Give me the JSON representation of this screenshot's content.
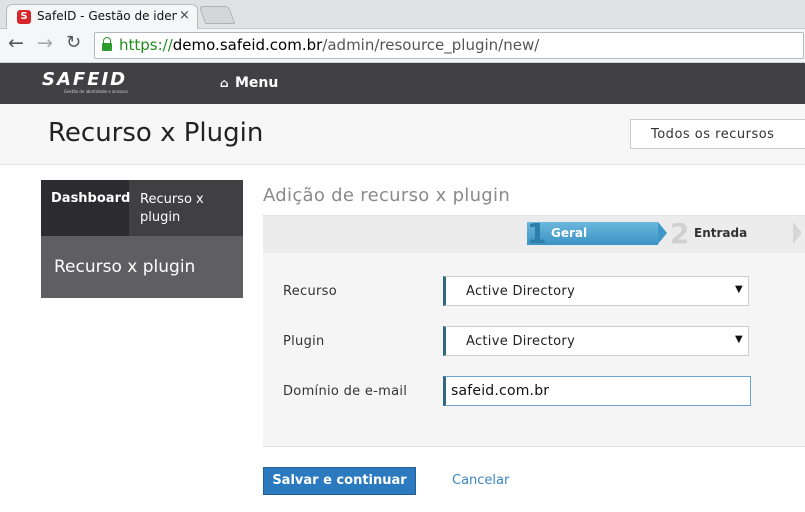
{
  "browser": {
    "tab_title": "SafeID - Gestão de identid",
    "tab_close": "×",
    "url_scheme": "https://",
    "url_host": "demo.safeid.com.br",
    "url_path": "/admin/resource_plugin/new/"
  },
  "appbar": {
    "logo": "SAFEID",
    "logo_tagline": "Gestão de identidade e acessos",
    "menu_label": "Menu",
    "menu_icon": "home-icon"
  },
  "header": {
    "title": "Recurso x Plugin",
    "all_resources": "Todos os recursos"
  },
  "sidebar": {
    "tab_dashboard": "Dashboard",
    "tab_resource_line1": "Recurso x",
    "tab_resource_line2": "plugin",
    "current": "Recurso x plugin"
  },
  "main": {
    "section_title": "Adição de recurso x plugin",
    "steps": [
      {
        "number": "1",
        "label": "Geral",
        "active": true
      },
      {
        "number": "2",
        "label": "Entrada",
        "active": false
      }
    ],
    "form": {
      "resource_label": "Recurso",
      "resource_value": "Active Directory",
      "plugin_label": "Plugin",
      "plugin_value": "Active Directory",
      "domain_label": "Domínio de e-mail",
      "domain_value": "safeid.com.br"
    },
    "save_button": "Salvar e continuar",
    "cancel_link": "Cancelar"
  },
  "colors": {
    "appbar": "#414144",
    "accent": "#2b7ac0",
    "step_active": "#3b93c5"
  }
}
